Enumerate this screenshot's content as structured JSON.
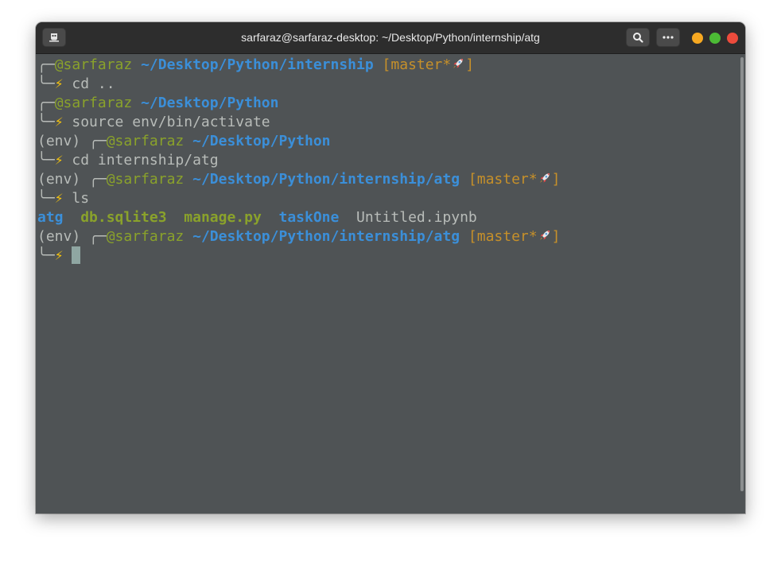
{
  "window": {
    "title": "sarfaraz@sarfaraz-desktop: ~/Desktop/Python/internship/atg"
  },
  "icons": {
    "new_tab": "terminal-tab-icon",
    "search": "search-icon",
    "menu": "more-menu-icon",
    "minimize": "minimize-dot-icon",
    "maximize": "maximize-dot-icon",
    "close": "close-dot-icon",
    "bolt": "lightning-icon",
    "rocket": "rocket-icon"
  },
  "colors": {
    "user": "#8aa22b",
    "path": "#3b8fd9",
    "branch": "#c6902a",
    "bolt": "#f4c20d",
    "background": "#4f5355",
    "minimize": "#f6a821",
    "maximize": "#4cbb35",
    "close": "#ec4b3c"
  },
  "terminal": {
    "box_top": "╭─",
    "box_bottom": "╰─",
    "bolt": "⚡",
    "env": "(env) ",
    "user": "@sarfaraz",
    "branch_open": "[master*",
    "branch_close": "]",
    "entries": [
      {
        "path": "~/Desktop/Python/internship",
        "command": "cd .."
      },
      {
        "path": "~/Desktop/Python",
        "command": "source env/bin/activate"
      },
      {
        "path": "~/Desktop/Python",
        "command": "cd internship/atg"
      },
      {
        "path": "~/Desktop/Python/internship/atg",
        "command": "ls"
      },
      {
        "path": "~/Desktop/Python/internship/atg",
        "command": ""
      }
    ],
    "ls_output": {
      "dir1": "atg",
      "exe1": "db.sqlite3",
      "exe2": "manage.py",
      "dir2": "taskOne",
      "file1": "Untitled.ipynb"
    }
  }
}
